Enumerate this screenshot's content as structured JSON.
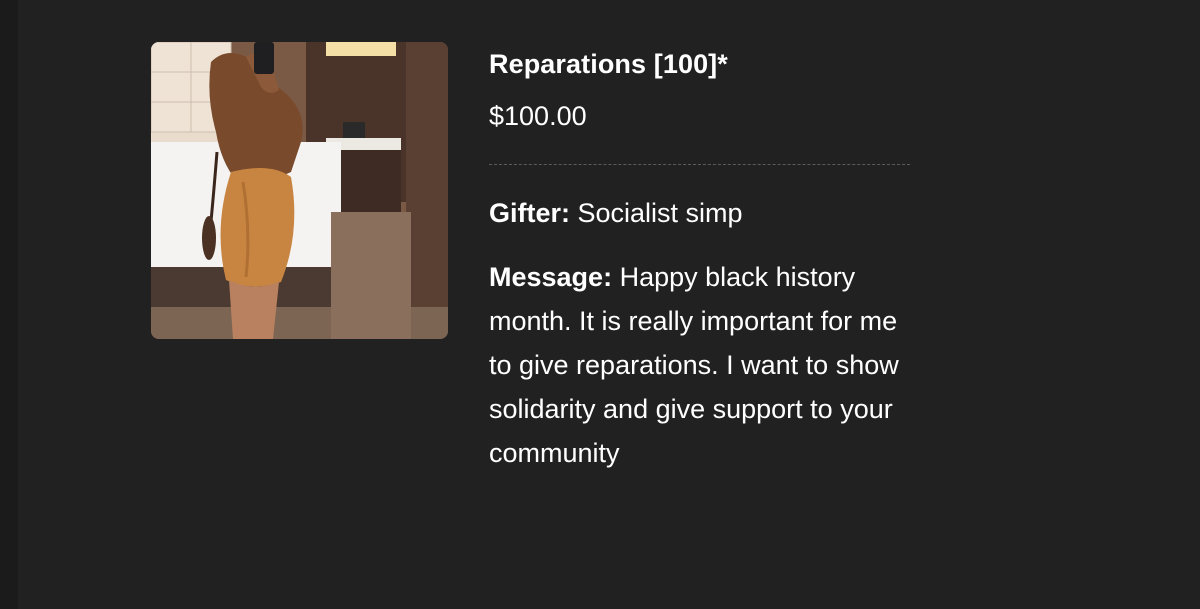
{
  "item": {
    "title": "Reparations [100]*",
    "price": "$100.00",
    "image_icon": "product-photo"
  },
  "gift": {
    "gifter_label": "Gifter:",
    "gifter_value": "Socialist simp",
    "message_label": "Message:",
    "message_value": "Happy black history month. It is really important for me to give reparations. I want to show solidarity and give support to your community"
  },
  "colors": {
    "background": "#222121",
    "text": "#ffffff",
    "divider": "#5b5b5b"
  }
}
